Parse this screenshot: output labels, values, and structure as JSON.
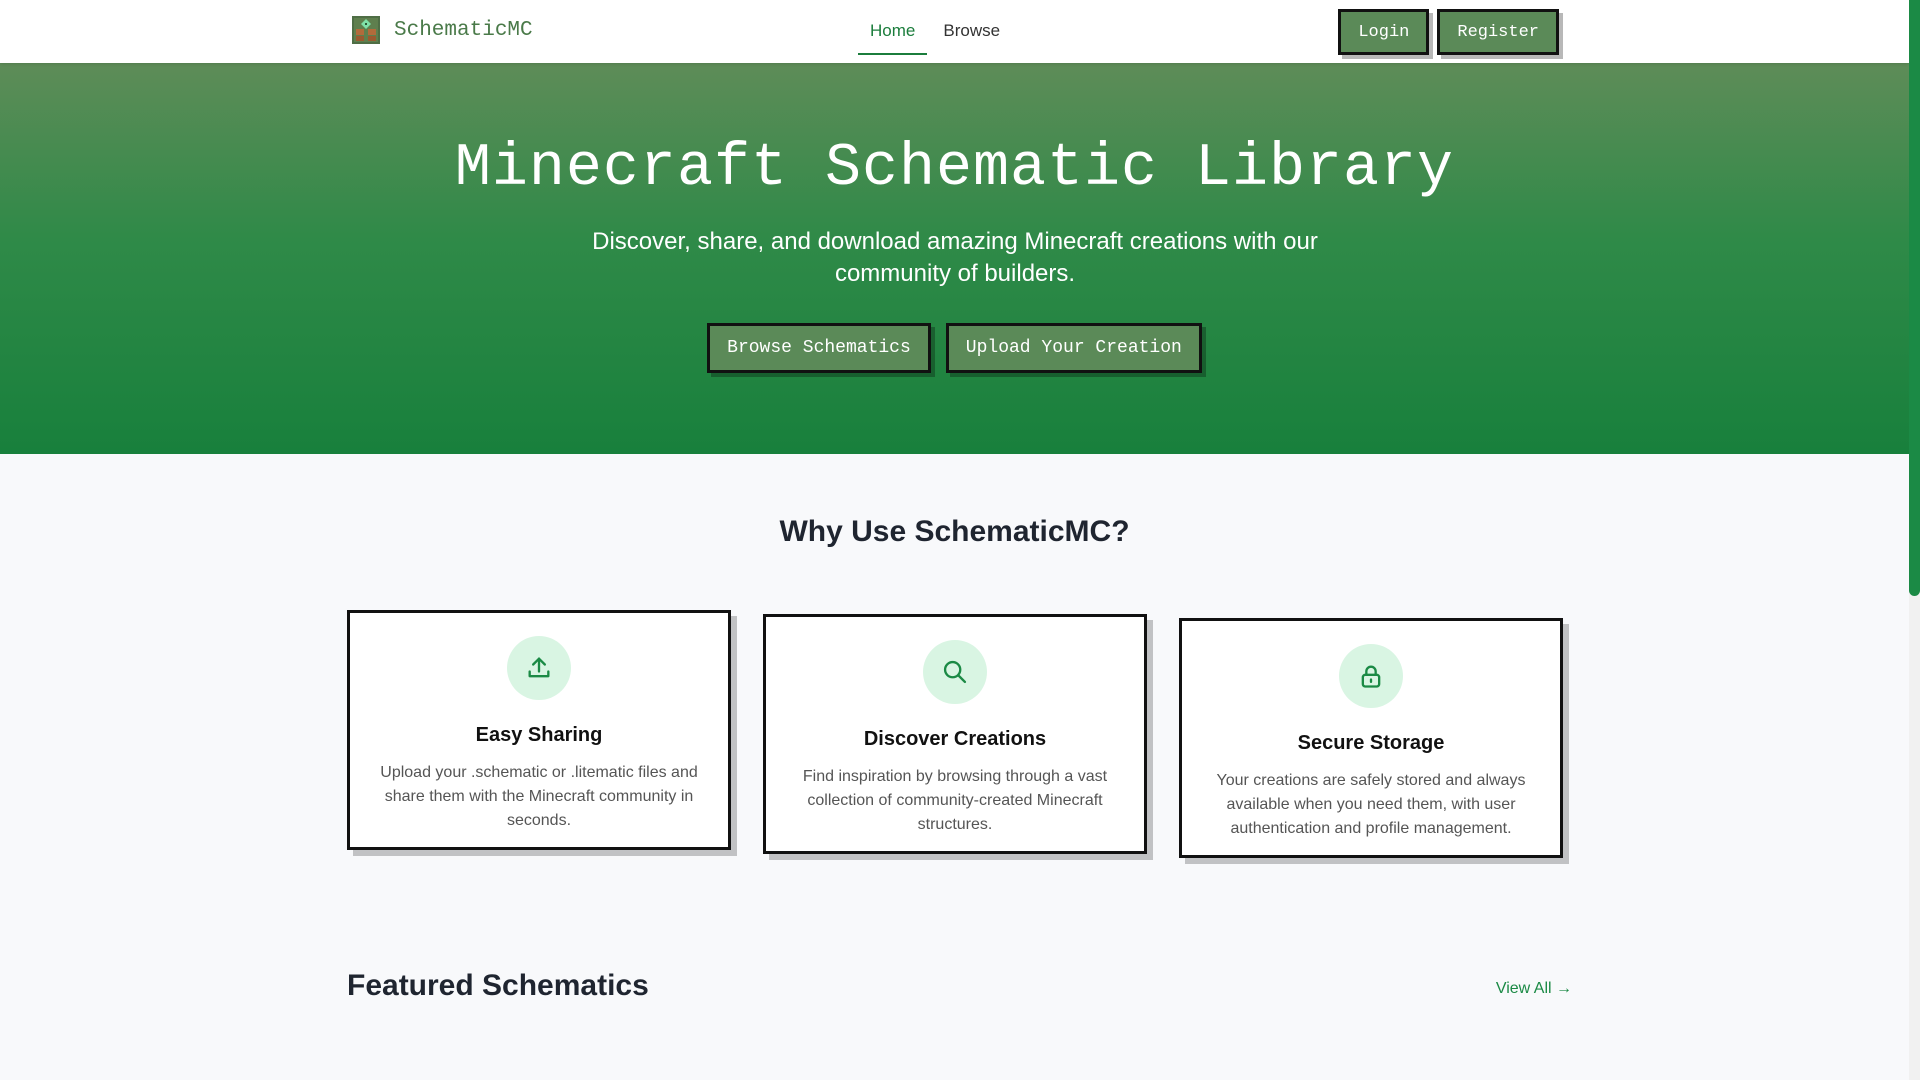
{
  "brand": {
    "name": "SchematicMC"
  },
  "nav": {
    "items": [
      {
        "label": "Home",
        "active": true
      },
      {
        "label": "Browse",
        "active": false
      }
    ]
  },
  "auth": {
    "login_label": "Login",
    "register_label": "Register"
  },
  "hero": {
    "title": "Minecraft Schematic Library",
    "subtitle": "Discover, share, and download amazing Minecraft creations with our community of builders.",
    "browse_label": "Browse Schematics",
    "upload_label": "Upload Your Creation"
  },
  "features": {
    "title": "Why Use SchematicMC?",
    "items": [
      {
        "icon": "upload-icon",
        "title": "Easy Sharing",
        "desc": "Upload your .schematic or .litematic files and share them with the Minecraft community in seconds."
      },
      {
        "icon": "search-icon",
        "title": "Discover Creations",
        "desc": "Find inspiration by browsing through a vast collection of community-created Minecraft structures."
      },
      {
        "icon": "lock-icon",
        "title": "Secure Storage",
        "desc": "Your creations are safely stored and always available when you need them, with user authentication and profile management."
      }
    ]
  },
  "featured": {
    "title": "Featured Schematics",
    "view_all_label": "View All →"
  },
  "colors": {
    "accent": "#1b8a45",
    "button": "#5b8a58",
    "icon_bg": "#d9f5e3"
  }
}
